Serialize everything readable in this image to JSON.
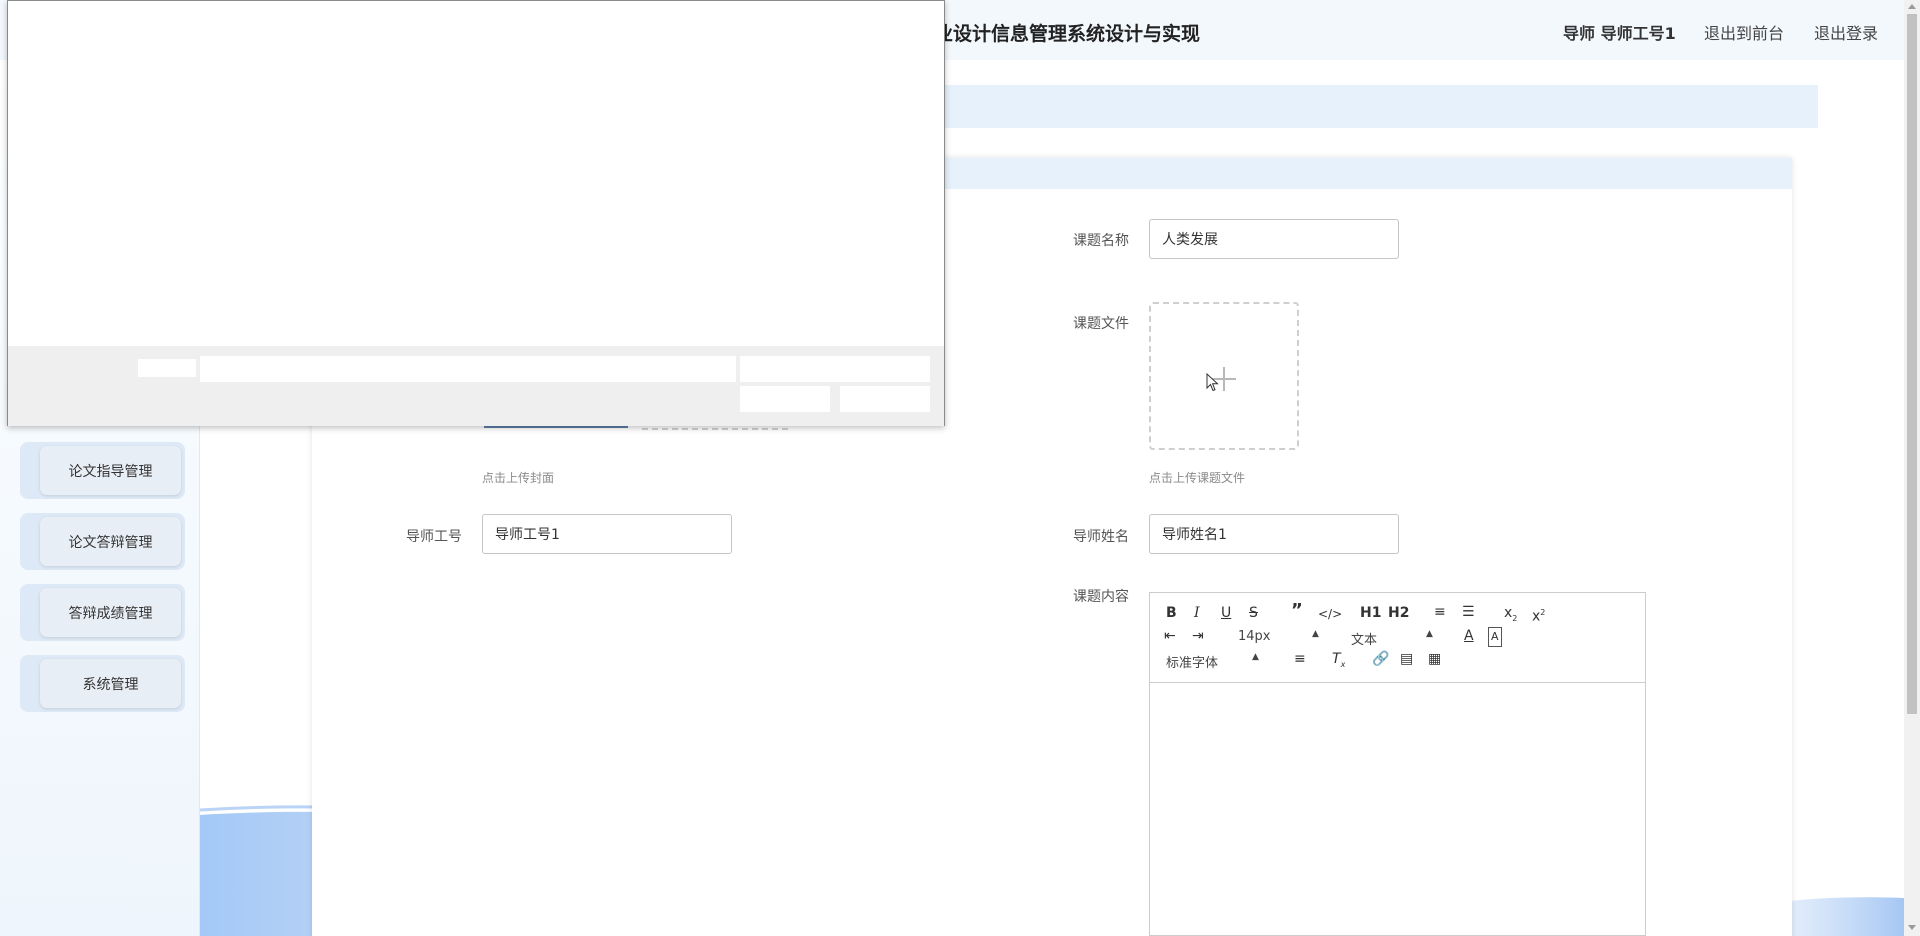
{
  "header": {
    "title": "业设计信息管理系统设计与实现",
    "user": "导师 导师工号1",
    "back_to_front": "退出到前台",
    "logout": "退出登录"
  },
  "sidebar": {
    "items": [
      {
        "label": "论文指导管理"
      },
      {
        "label": "论文答辩管理"
      },
      {
        "label": "答辩成绩管理"
      },
      {
        "label": "系统管理"
      }
    ]
  },
  "form": {
    "topic_name_label": "课题名称",
    "topic_name_value": "人类发展",
    "topic_file_label": "课题文件",
    "cover_hint": "点击上传封面",
    "file_hint": "点击上传课题文件",
    "teacher_id_label": "导师工号",
    "teacher_id_value": "导师工号1",
    "teacher_name_label": "导师姓名",
    "teacher_name_value": "导师姓名1",
    "content_label": "课题内容"
  },
  "editor": {
    "font_size": "14px",
    "heading_select": "文本",
    "font_family": "标准字体",
    "h1": "H1",
    "h2": "H2"
  },
  "colors": {
    "accent_light": "#e6f1fc",
    "header_bg": "#f3f8fd",
    "wave": "#4a8ee8"
  }
}
